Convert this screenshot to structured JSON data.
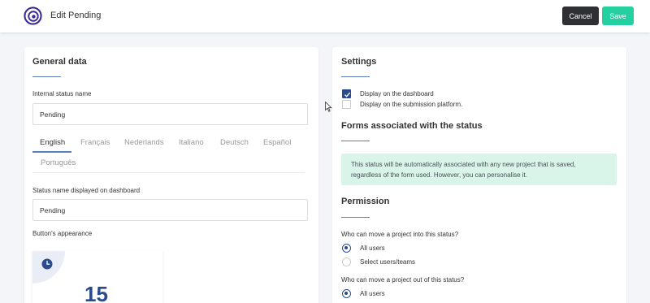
{
  "header": {
    "title": "Edit Pending",
    "cancel_label": "Cancel",
    "save_label": "Save"
  },
  "general": {
    "title": "General data",
    "internal_name_label": "Internal status name",
    "internal_name_value": "Pending",
    "languages": [
      "English",
      "Français",
      "Nederlands",
      "Italiano",
      "Deutsch",
      "Español",
      "Português"
    ],
    "active_language": "English",
    "dashboard_name_label": "Status name displayed on dashboard",
    "dashboard_name_value": "Pending",
    "appearance_label": "Button's appearance",
    "preview_count": "15"
  },
  "settings": {
    "title": "Settings",
    "options": [
      {
        "label": "Display on the dashboard",
        "checked": true
      },
      {
        "label": "Display on the submission platform.",
        "checked": false
      }
    ],
    "forms_title": "Forms associated with the status",
    "forms_info": "This status will be automatically associated with any new project that is saved, regardless of the form used. However, you can personalise it.",
    "permission_title": "Permission",
    "move_into_question": "Who can move a project into this status?",
    "move_into_options": [
      {
        "label": "All users",
        "selected": true
      },
      {
        "label": "Select users/teams",
        "selected": false
      }
    ],
    "move_out_question": "Who can move a project out of this status?",
    "move_out_options": [
      {
        "label": "All users",
        "selected": true
      }
    ]
  },
  "colors": {
    "accent_blue": "#2b4c8c",
    "save_green": "#24d0a0",
    "cancel_dark": "#2f3033",
    "info_bg": "#d9f5ea"
  },
  "icons": [
    "logo-icon",
    "clock-icon",
    "checkmark-icon",
    "mouse-cursor-icon"
  ]
}
